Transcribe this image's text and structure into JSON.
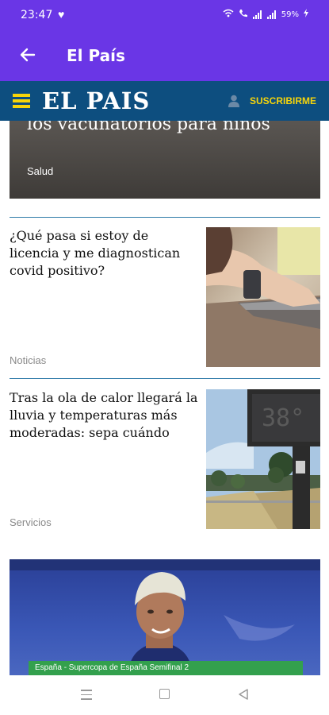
{
  "status_bar": {
    "time": "23:47",
    "battery": "59%"
  },
  "app_bar": {
    "title": "El País",
    "back_icon": "arrow-left-icon"
  },
  "site_header": {
    "logo": "EL PAIS",
    "subscribe_label": "SUSCRIBIRME",
    "menu_icon": "hamburger-icon",
    "user_icon": "user-icon",
    "brand_color": "#0d4e7f",
    "accent_color": "#f6d40a"
  },
  "feed": {
    "top_card": {
      "title": "los vacunatorios para niños",
      "section": "Salud"
    },
    "articles": [
      {
        "title": "¿Qué pasa si estoy de licencia y me diagnostican covid positivo?",
        "section": "Noticias",
        "image": "laptop-hands"
      },
      {
        "title": "Tras la ola de calor llegará la lluvia y temperaturas más moderadas: sepa cuándo",
        "section": "Servicios",
        "image": "street-thermometer",
        "thermometer_reading": "38°"
      }
    ],
    "photo_card": {
      "caption": "España - Supercopa de España Semifinal 2"
    }
  },
  "colors": {
    "status_bar": "#6a36e6",
    "divider": "#2e7aa8"
  }
}
